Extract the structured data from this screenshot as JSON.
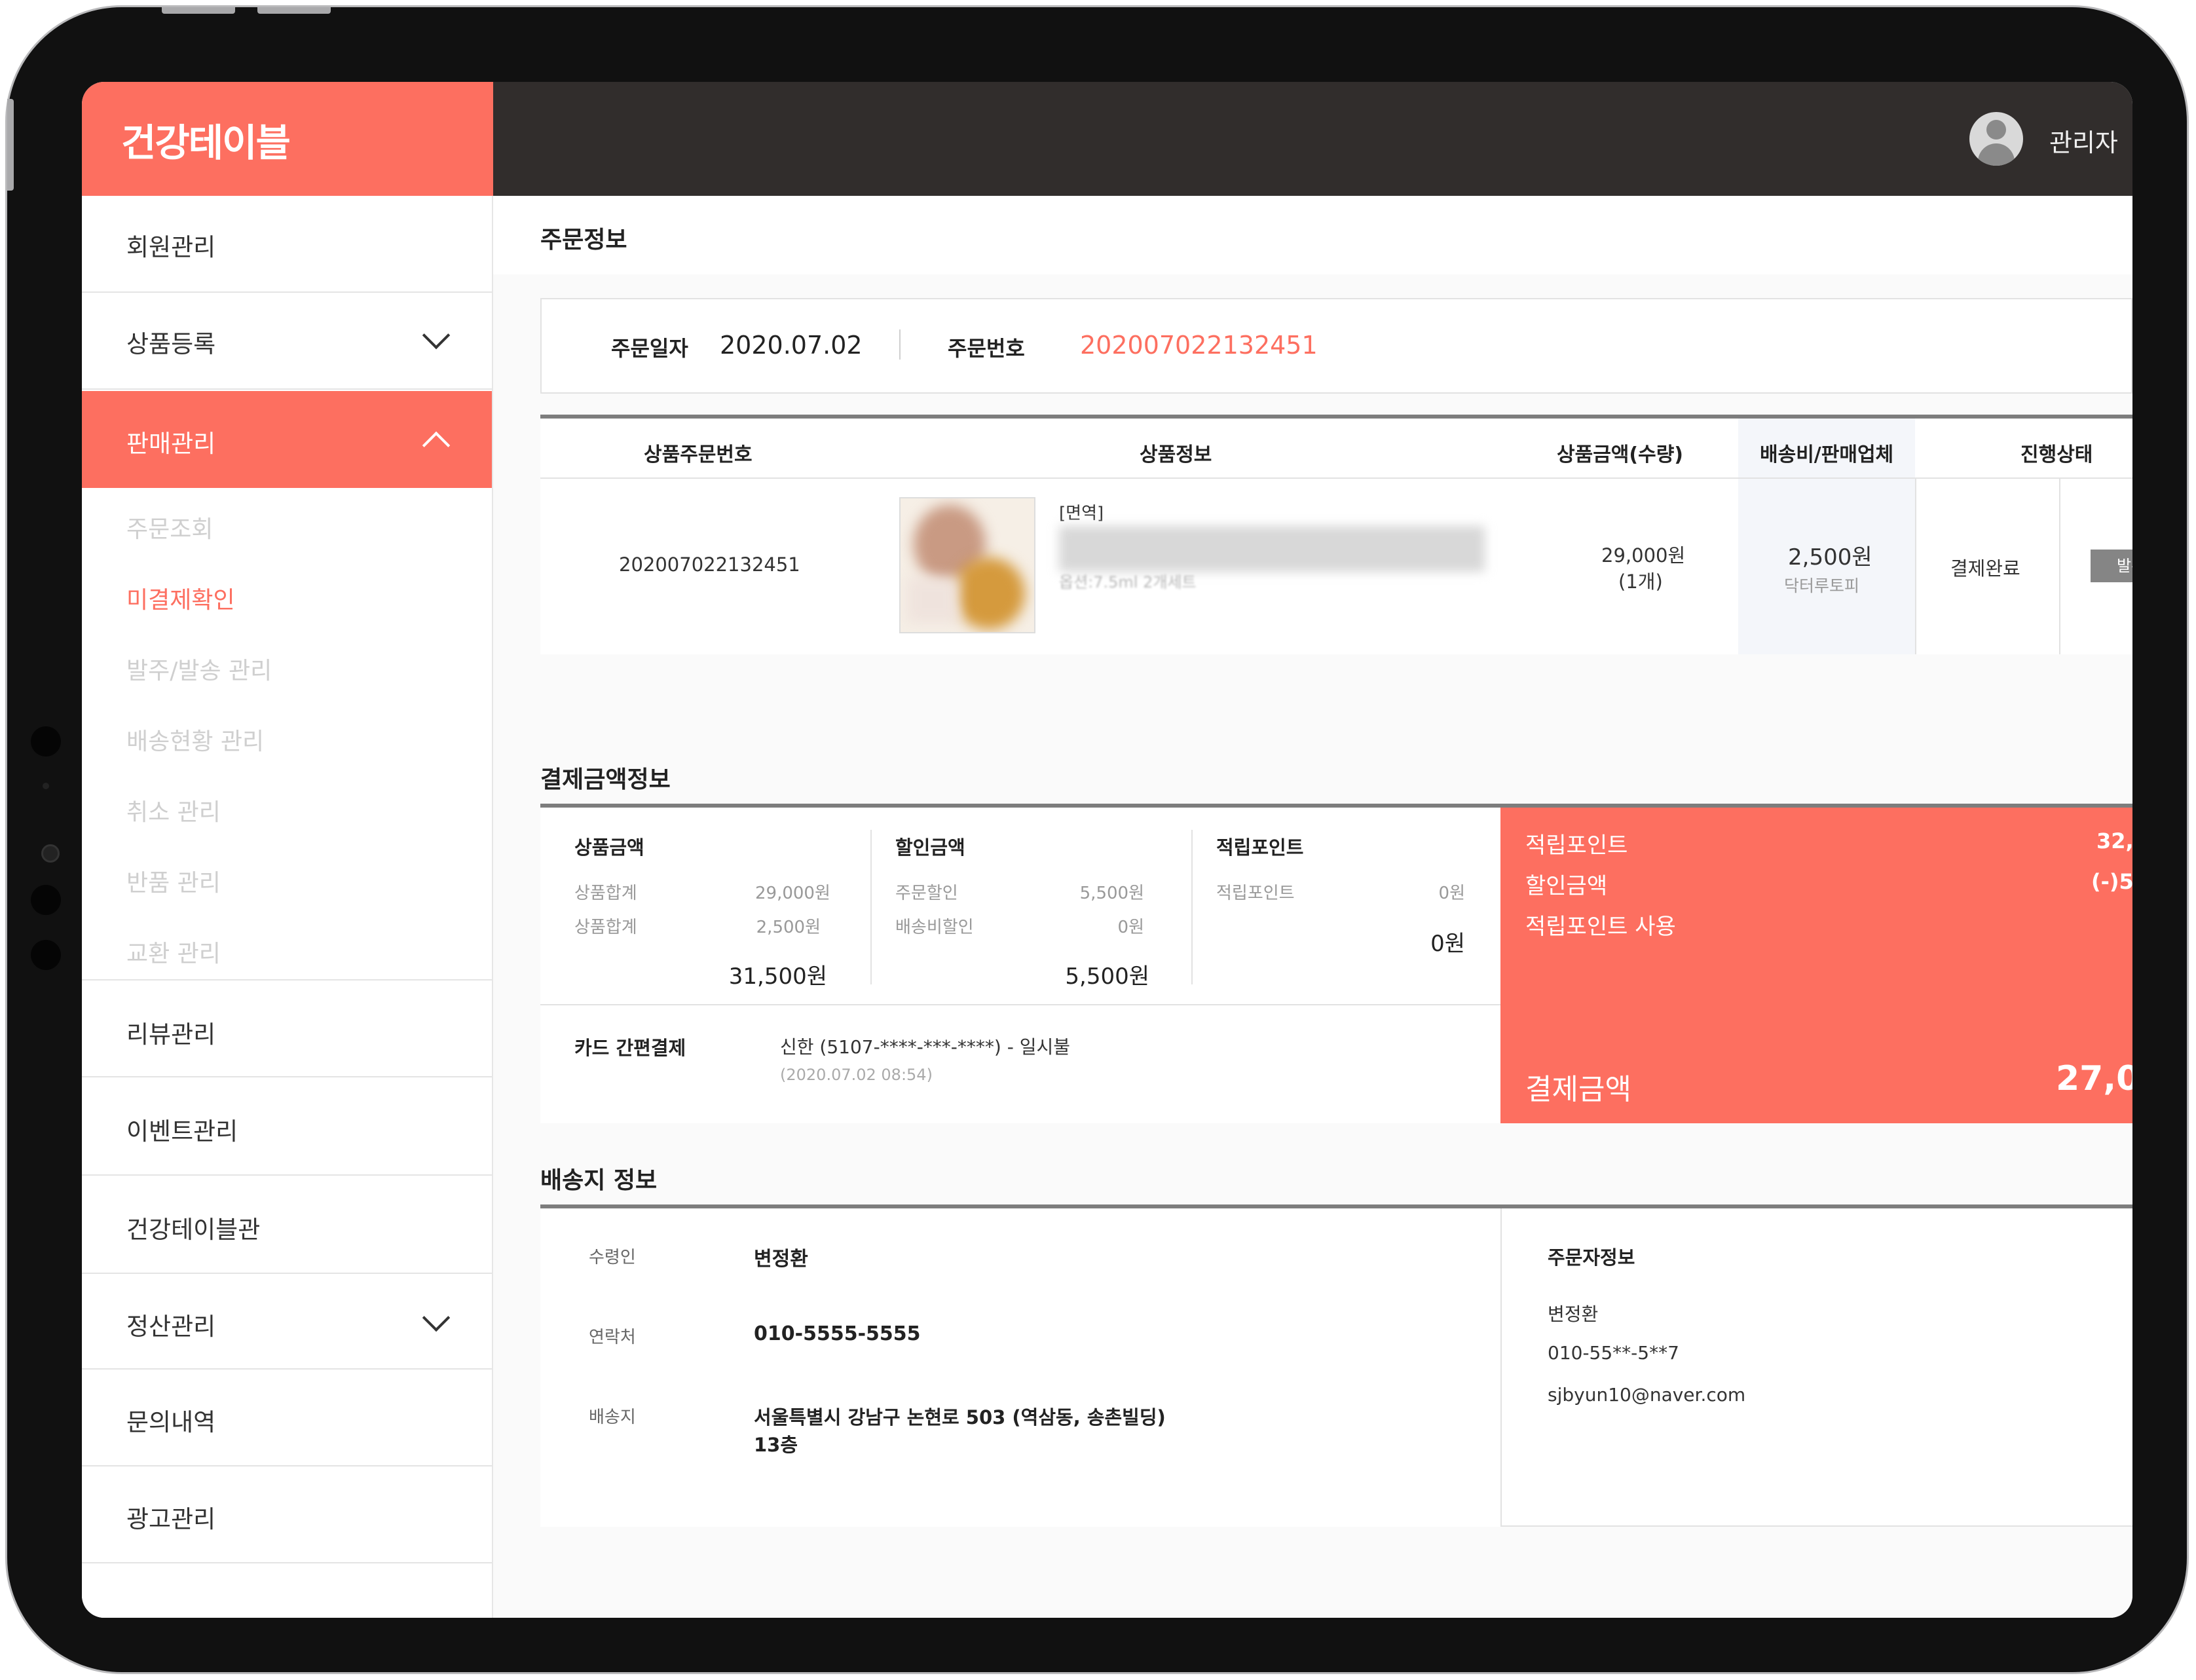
{
  "brand": {
    "logo": "건강테이블",
    "accent": "#fd6f60",
    "topbar_color": "#312d2c"
  },
  "header": {
    "user_label": "관리자",
    "avatar_icon": "user-avatar-icon"
  },
  "sidebar": {
    "items": [
      {
        "label": "회원관리"
      },
      {
        "label": "상품등록",
        "icon": "chevron-down-icon"
      },
      {
        "label": "판매관리",
        "icon": "chevron-up-icon",
        "active": true
      },
      {
        "label": "리뷰관리"
      },
      {
        "label": "이벤트관리"
      },
      {
        "label": "건강테이블관"
      },
      {
        "label": "정산관리",
        "icon": "chevron-down-icon"
      },
      {
        "label": "문의내역"
      },
      {
        "label": "광고관리"
      }
    ],
    "sub_items": [
      {
        "label": "주문조회"
      },
      {
        "label": "미결제확인",
        "active": true
      },
      {
        "label": "발주/발송 관리"
      },
      {
        "label": "배송현황 관리"
      },
      {
        "label": "취소 관리"
      },
      {
        "label": "반품 관리"
      },
      {
        "label": "교환 관리"
      }
    ]
  },
  "order_info": {
    "title": "주문정보",
    "date_label": "주문일자",
    "date_value": "2020.07.02",
    "number_label": "주문번호",
    "number_value": "202007022132451",
    "table": {
      "headers": [
        "상품주문번호",
        "상품정보",
        "상품금액(수량)",
        "배송비/판매업체",
        "진행상태"
      ],
      "row": {
        "order_no": "202007022132451",
        "product_tag": "[면역]",
        "product_option": "옵션:7.5ml 2개세트",
        "price": "29,000원",
        "qty": "(1개)",
        "shipping_fee": "2,500원",
        "vendor": "닥터루토피",
        "status": "결제완료",
        "action_label": "발주"
      }
    }
  },
  "payment": {
    "title": "결제금액정보",
    "product_amount": {
      "heading": "상품금액",
      "rows": [
        {
          "label": "상품합계",
          "value": "29,000원"
        },
        {
          "label": "상품합계",
          "value": "2,500원"
        }
      ],
      "total": "31,500원"
    },
    "discount_amount": {
      "heading": "할인금액",
      "rows": [
        {
          "label": "주문할인",
          "value": "5,500원"
        },
        {
          "label": "배송비할인",
          "value": "0원"
        }
      ],
      "total": "5,500원"
    },
    "points": {
      "heading": "적립포인트",
      "rows": [
        {
          "label": "적립포인트",
          "value": "0원"
        }
      ],
      "total": "0원"
    },
    "method_label": "카드 간편결제",
    "method_value": "신한 (5107-****-***-****) - 일시불",
    "method_time": "(2020.07.02 08:54)",
    "summary": {
      "rows": [
        {
          "label": "적립포인트",
          "value": "32,"
        },
        {
          "label": "할인금액",
          "value": "(-)5,"
        },
        {
          "label": "적립포인트 사용",
          "value": ""
        }
      ],
      "total_label": "결제금액",
      "total_value": "27,0"
    }
  },
  "delivery": {
    "title": "배송지 정보",
    "receiver_label": "수령인",
    "receiver_value": "변정환",
    "phone_label": "연락처",
    "phone_value": "010-5555-5555",
    "address_label": "배송지",
    "address_line1": "서울특별시 강남구 논현로 503 (역삼동, 송촌빌딩)",
    "address_line2": "13층",
    "orderer_title": "주문자정보",
    "orderer_name": "변정환",
    "orderer_phone": "010-55**-5**7",
    "orderer_email": "sjbyun10@naver.com"
  }
}
